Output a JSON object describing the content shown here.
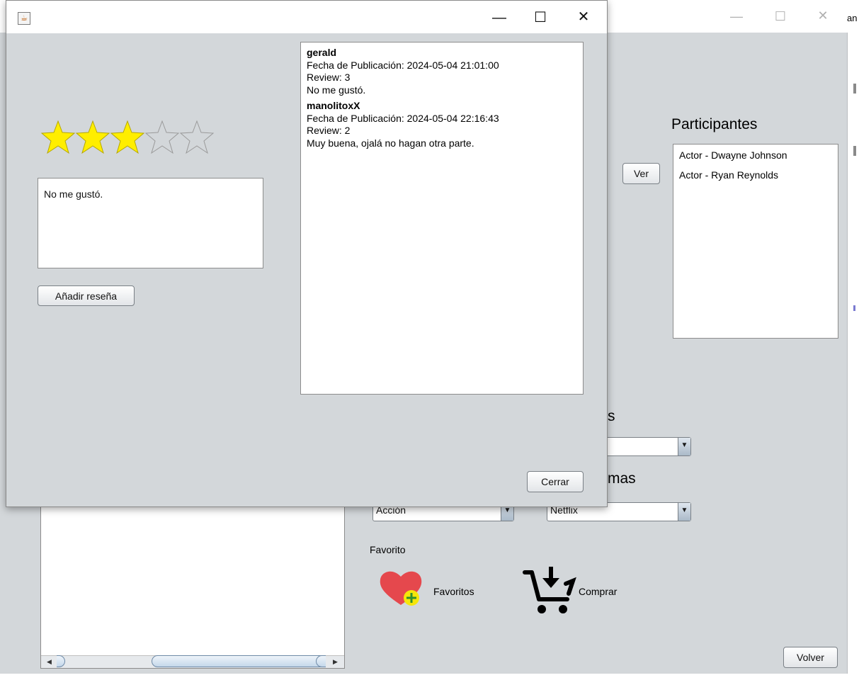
{
  "background_window": {
    "edge_text": "an",
    "participantes_title": "Participantes",
    "participants": [
      "Actor - Dwayne Johnson",
      "Actor - Ryan Reynolds"
    ],
    "ver_label": "Ver",
    "partial_label_s": "s",
    "partial_label_mas": "mas",
    "genre_combo": "Acción",
    "platform_combo": "Netflix",
    "favorito_label": "Favorito",
    "favoritos_label": "Favoritos",
    "comprar_label": "Comprar",
    "volver_label": "Volver"
  },
  "dialog": {
    "rating": 3,
    "max_rating": 5,
    "review_text": "No me gustó.",
    "add_review_label": "Añadir reseña",
    "close_label": "Cerrar",
    "reviews": [
      {
        "user": "gerald",
        "date_line": "Fecha de Publicación: 2024-05-04 21:01:00",
        "score_line": "Review: 3",
        "comment": "No me gustó."
      },
      {
        "user": "manolitoxX",
        "date_line": "Fecha de Publicación: 2024-05-04 22:16:43",
        "score_line": "Review: 2",
        "comment": "Muy buena, ojalá no hagan otra parte."
      }
    ]
  },
  "colors": {
    "panel_bg": "#d3d7da",
    "star_filled": "#ffee00",
    "heart": "#e5484d",
    "heart_badge": "#f5e60a"
  }
}
